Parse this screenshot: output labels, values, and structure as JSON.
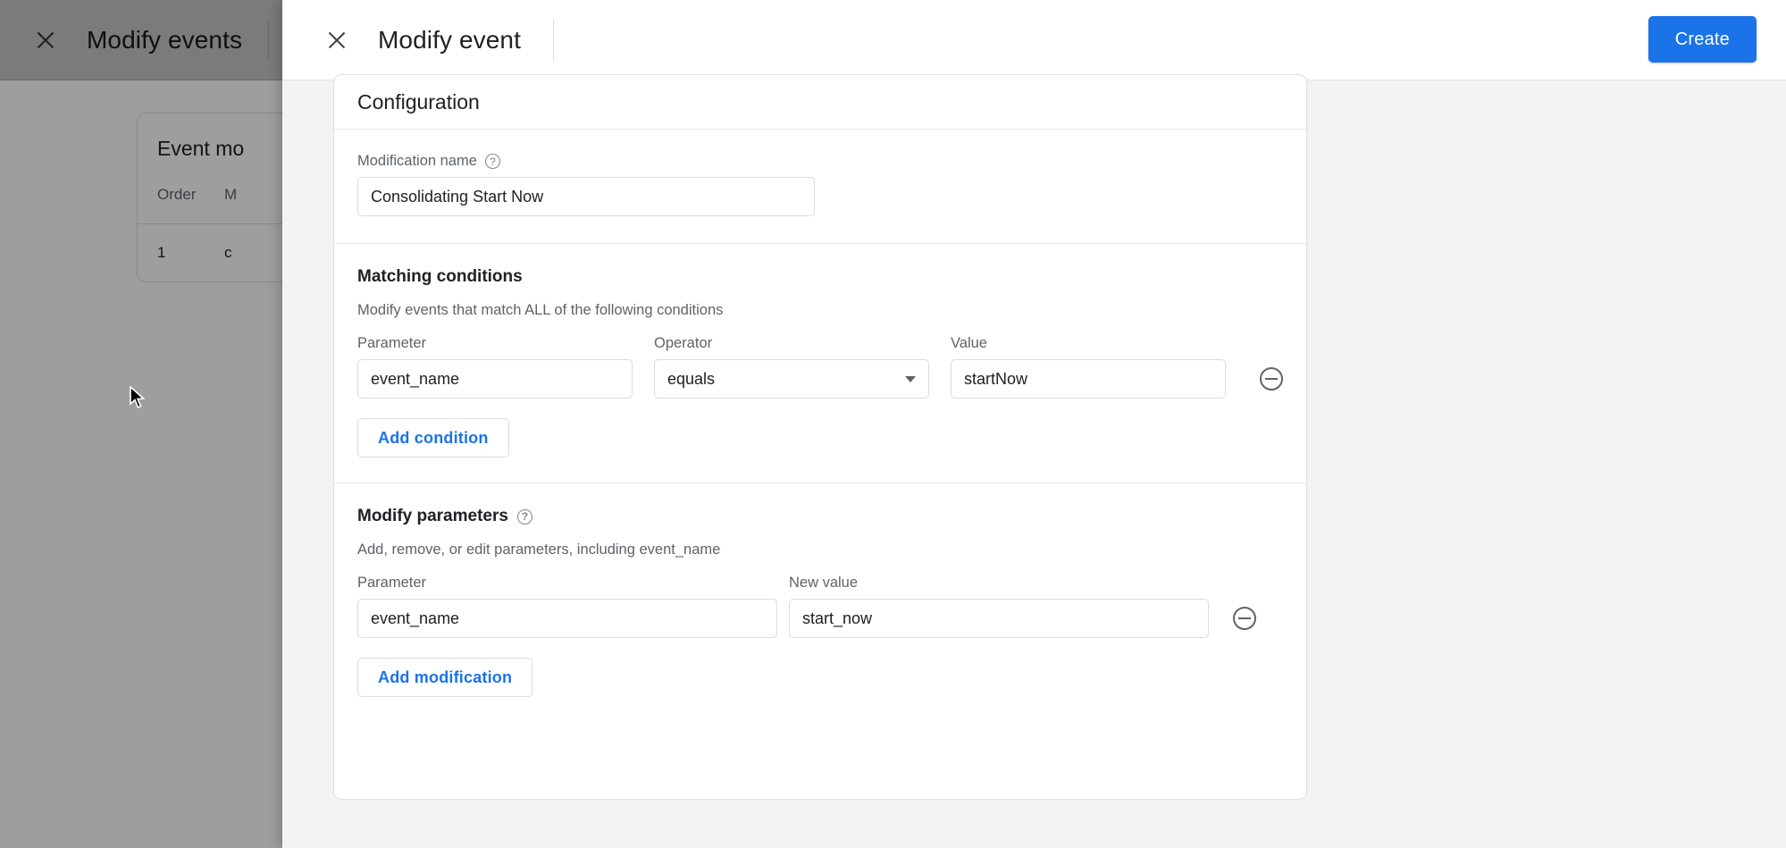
{
  "background": {
    "close_icon": "close-icon",
    "title": "Modify events",
    "card": {
      "title": "Event mo",
      "columns": [
        "Order",
        "M"
      ],
      "rows": [
        [
          "1",
          "c"
        ]
      ]
    }
  },
  "panel": {
    "close_icon": "close-icon",
    "title": "Modify event",
    "create_label": "Create"
  },
  "config": {
    "header": "Configuration",
    "modification_name": {
      "label": "Modification name",
      "help_icon": "help-icon",
      "value": "Consolidating Start Now",
      "placeholder": ""
    },
    "matching_conditions": {
      "title": "Matching conditions",
      "subtitle": "Modify events that match ALL of the following conditions",
      "labels": {
        "parameter": "Parameter",
        "operator": "Operator",
        "value": "Value"
      },
      "rows": [
        {
          "parameter": "event_name",
          "operator": "equals",
          "value": "startNow",
          "remove_icon": "minus-circle-icon"
        }
      ],
      "add_label": "Add condition"
    },
    "modify_parameters": {
      "title": "Modify parameters",
      "help_icon": "help-icon",
      "subtitle": "Add, remove, or edit parameters, including event_name",
      "labels": {
        "parameter": "Parameter",
        "new_value": "New value"
      },
      "rows": [
        {
          "parameter": "event_name",
          "new_value": "start_now",
          "remove_icon": "minus-circle-icon"
        }
      ],
      "add_label": "Add modification"
    }
  },
  "colors": {
    "accent": "#1a73e8",
    "text": "#202124",
    "muted": "#5f6368",
    "panel_bg": "#f1f3f4",
    "border": "#dadce0"
  }
}
